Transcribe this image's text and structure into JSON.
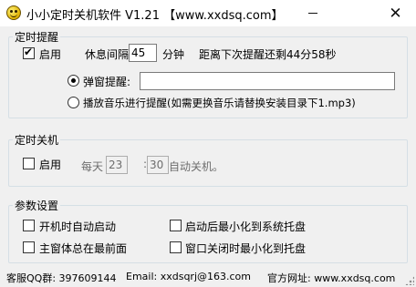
{
  "window": {
    "title": "小小定时关机软件 V1.21 【www.xxdsq.com】",
    "minimize_glyph": "—",
    "close_glyph": "✕",
    "icon": "smiley-face-icon"
  },
  "reminder": {
    "group_title": "定时提醒",
    "enable_label": "启用",
    "enable_checked": true,
    "interval_label": "休息间隔",
    "interval_value": "45",
    "interval_unit": "分钟",
    "countdown_text": "距离下次提醒还剩44分58秒",
    "popup_label": "弹窗提醒:",
    "popup_value": "",
    "popup_selected": true,
    "music_label": "播放音乐进行提醒(如需更换音乐请替换安装目录下1.mp3)",
    "music_selected": false
  },
  "shutdown": {
    "group_title": "定时关机",
    "enable_label": "启用",
    "enable_checked": false,
    "daily_label": "每天",
    "hour_value": "23",
    "colon": ":",
    "minute_value": "30",
    "suffix_label": "自动关机。"
  },
  "settings": {
    "group_title": "参数设置",
    "options": [
      {
        "label": "开机时自动启动",
        "checked": false
      },
      {
        "label": "启动后最小化到系统托盘",
        "checked": false
      },
      {
        "label": "主窗体总在最前面",
        "checked": false
      },
      {
        "label": "窗口关闭时最小化到托盘",
        "checked": false
      }
    ]
  },
  "footer": {
    "qq": "客服QQ群: 397609144",
    "email": "Email: xxdsqrj@163.com",
    "website": "官方网址: www.xxdsq.com"
  }
}
